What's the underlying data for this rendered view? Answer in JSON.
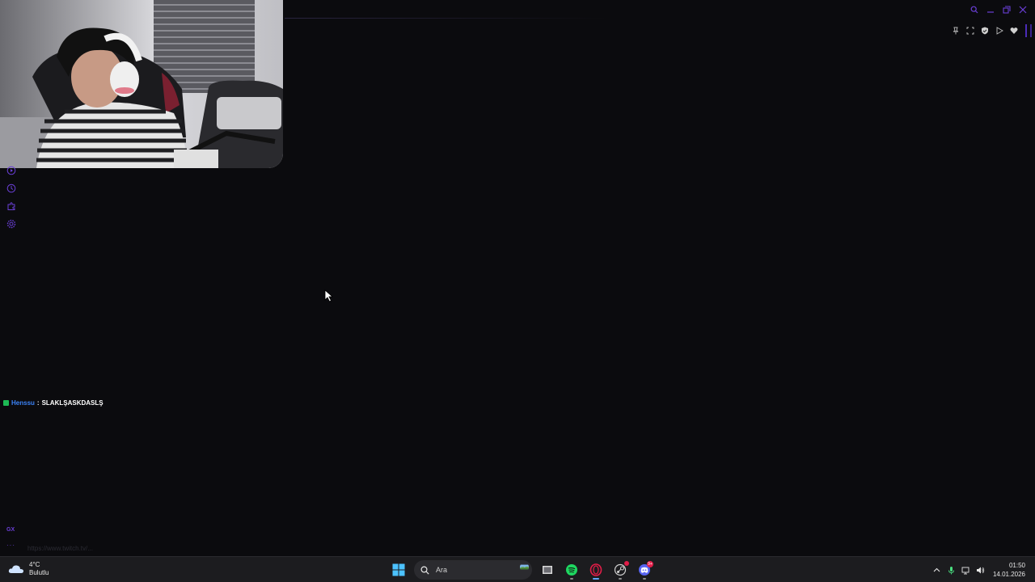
{
  "browser": {
    "accent_color": "#6a3fd6",
    "sidebar": {
      "items": [
        {
          "icon": "play-circle-icon"
        },
        {
          "icon": "history-clock-icon"
        },
        {
          "icon": "extensions-puzzle-icon"
        },
        {
          "icon": "settings-gear-icon"
        }
      ],
      "gx_label": "GX",
      "more_label": "···"
    },
    "status_url": "https://www.twitch.tv/..."
  },
  "chat": {
    "badge_color": "#1db954",
    "username": "Henssu",
    "separator": ":",
    "message": "SLAKLŞASKDASLŞ",
    "username_color": "#3b82f6"
  },
  "window_controls": [
    "search-icon",
    "minimize-icon",
    "restore-icon",
    "close-icon"
  ],
  "extensions": [
    "pin-icon",
    "snapshot-icon",
    "shield-icon",
    "play-icon",
    "heart-icon"
  ],
  "taskbar": {
    "weather": {
      "temp": "4°C",
      "condition": "Bulutlu",
      "icon": "cloud-icon"
    },
    "search": {
      "placeholder": "Ara"
    },
    "apps": [
      {
        "name": "windows-start-icon"
      },
      {
        "name": "file-explorer-icon"
      },
      {
        "name": "spotify-icon",
        "color": "#1ed760"
      },
      {
        "name": "opera-gx-icon",
        "color": "#e11d48",
        "active": true
      },
      {
        "name": "steam-icon"
      },
      {
        "name": "discord-icon",
        "color": "#5865f2",
        "badge": "9+"
      }
    ],
    "tray": [
      "chevron-up-icon",
      "microphone-icon",
      "network-icon",
      "volume-icon"
    ],
    "clock": {
      "time": "01:50",
      "date": "14.01.2026"
    }
  }
}
